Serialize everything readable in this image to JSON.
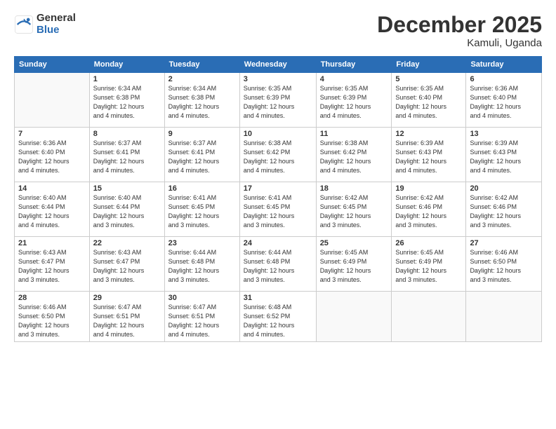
{
  "logo": {
    "general": "General",
    "blue": "Blue"
  },
  "title": "December 2025",
  "location": "Kamuli, Uganda",
  "days_of_week": [
    "Sunday",
    "Monday",
    "Tuesday",
    "Wednesday",
    "Thursday",
    "Friday",
    "Saturday"
  ],
  "weeks": [
    [
      {
        "day": "",
        "info": ""
      },
      {
        "day": "1",
        "info": "Sunrise: 6:34 AM\nSunset: 6:38 PM\nDaylight: 12 hours\nand 4 minutes."
      },
      {
        "day": "2",
        "info": "Sunrise: 6:34 AM\nSunset: 6:38 PM\nDaylight: 12 hours\nand 4 minutes."
      },
      {
        "day": "3",
        "info": "Sunrise: 6:35 AM\nSunset: 6:39 PM\nDaylight: 12 hours\nand 4 minutes."
      },
      {
        "day": "4",
        "info": "Sunrise: 6:35 AM\nSunset: 6:39 PM\nDaylight: 12 hours\nand 4 minutes."
      },
      {
        "day": "5",
        "info": "Sunrise: 6:35 AM\nSunset: 6:40 PM\nDaylight: 12 hours\nand 4 minutes."
      },
      {
        "day": "6",
        "info": "Sunrise: 6:36 AM\nSunset: 6:40 PM\nDaylight: 12 hours\nand 4 minutes."
      }
    ],
    [
      {
        "day": "7",
        "info": "Sunrise: 6:36 AM\nSunset: 6:40 PM\nDaylight: 12 hours\nand 4 minutes."
      },
      {
        "day": "8",
        "info": "Sunrise: 6:37 AM\nSunset: 6:41 PM\nDaylight: 12 hours\nand 4 minutes."
      },
      {
        "day": "9",
        "info": "Sunrise: 6:37 AM\nSunset: 6:41 PM\nDaylight: 12 hours\nand 4 minutes."
      },
      {
        "day": "10",
        "info": "Sunrise: 6:38 AM\nSunset: 6:42 PM\nDaylight: 12 hours\nand 4 minutes."
      },
      {
        "day": "11",
        "info": "Sunrise: 6:38 AM\nSunset: 6:42 PM\nDaylight: 12 hours\nand 4 minutes."
      },
      {
        "day": "12",
        "info": "Sunrise: 6:39 AM\nSunset: 6:43 PM\nDaylight: 12 hours\nand 4 minutes."
      },
      {
        "day": "13",
        "info": "Sunrise: 6:39 AM\nSunset: 6:43 PM\nDaylight: 12 hours\nand 4 minutes."
      }
    ],
    [
      {
        "day": "14",
        "info": "Sunrise: 6:40 AM\nSunset: 6:44 PM\nDaylight: 12 hours\nand 4 minutes."
      },
      {
        "day": "15",
        "info": "Sunrise: 6:40 AM\nSunset: 6:44 PM\nDaylight: 12 hours\nand 3 minutes."
      },
      {
        "day": "16",
        "info": "Sunrise: 6:41 AM\nSunset: 6:45 PM\nDaylight: 12 hours\nand 3 minutes."
      },
      {
        "day": "17",
        "info": "Sunrise: 6:41 AM\nSunset: 6:45 PM\nDaylight: 12 hours\nand 3 minutes."
      },
      {
        "day": "18",
        "info": "Sunrise: 6:42 AM\nSunset: 6:45 PM\nDaylight: 12 hours\nand 3 minutes."
      },
      {
        "day": "19",
        "info": "Sunrise: 6:42 AM\nSunset: 6:46 PM\nDaylight: 12 hours\nand 3 minutes."
      },
      {
        "day": "20",
        "info": "Sunrise: 6:42 AM\nSunset: 6:46 PM\nDaylight: 12 hours\nand 3 minutes."
      }
    ],
    [
      {
        "day": "21",
        "info": "Sunrise: 6:43 AM\nSunset: 6:47 PM\nDaylight: 12 hours\nand 3 minutes."
      },
      {
        "day": "22",
        "info": "Sunrise: 6:43 AM\nSunset: 6:47 PM\nDaylight: 12 hours\nand 3 minutes."
      },
      {
        "day": "23",
        "info": "Sunrise: 6:44 AM\nSunset: 6:48 PM\nDaylight: 12 hours\nand 3 minutes."
      },
      {
        "day": "24",
        "info": "Sunrise: 6:44 AM\nSunset: 6:48 PM\nDaylight: 12 hours\nand 3 minutes."
      },
      {
        "day": "25",
        "info": "Sunrise: 6:45 AM\nSunset: 6:49 PM\nDaylight: 12 hours\nand 3 minutes."
      },
      {
        "day": "26",
        "info": "Sunrise: 6:45 AM\nSunset: 6:49 PM\nDaylight: 12 hours\nand 3 minutes."
      },
      {
        "day": "27",
        "info": "Sunrise: 6:46 AM\nSunset: 6:50 PM\nDaylight: 12 hours\nand 3 minutes."
      }
    ],
    [
      {
        "day": "28",
        "info": "Sunrise: 6:46 AM\nSunset: 6:50 PM\nDaylight: 12 hours\nand 3 minutes."
      },
      {
        "day": "29",
        "info": "Sunrise: 6:47 AM\nSunset: 6:51 PM\nDaylight: 12 hours\nand 4 minutes."
      },
      {
        "day": "30",
        "info": "Sunrise: 6:47 AM\nSunset: 6:51 PM\nDaylight: 12 hours\nand 4 minutes."
      },
      {
        "day": "31",
        "info": "Sunrise: 6:48 AM\nSunset: 6:52 PM\nDaylight: 12 hours\nand 4 minutes."
      },
      {
        "day": "",
        "info": ""
      },
      {
        "day": "",
        "info": ""
      },
      {
        "day": "",
        "info": ""
      }
    ]
  ]
}
